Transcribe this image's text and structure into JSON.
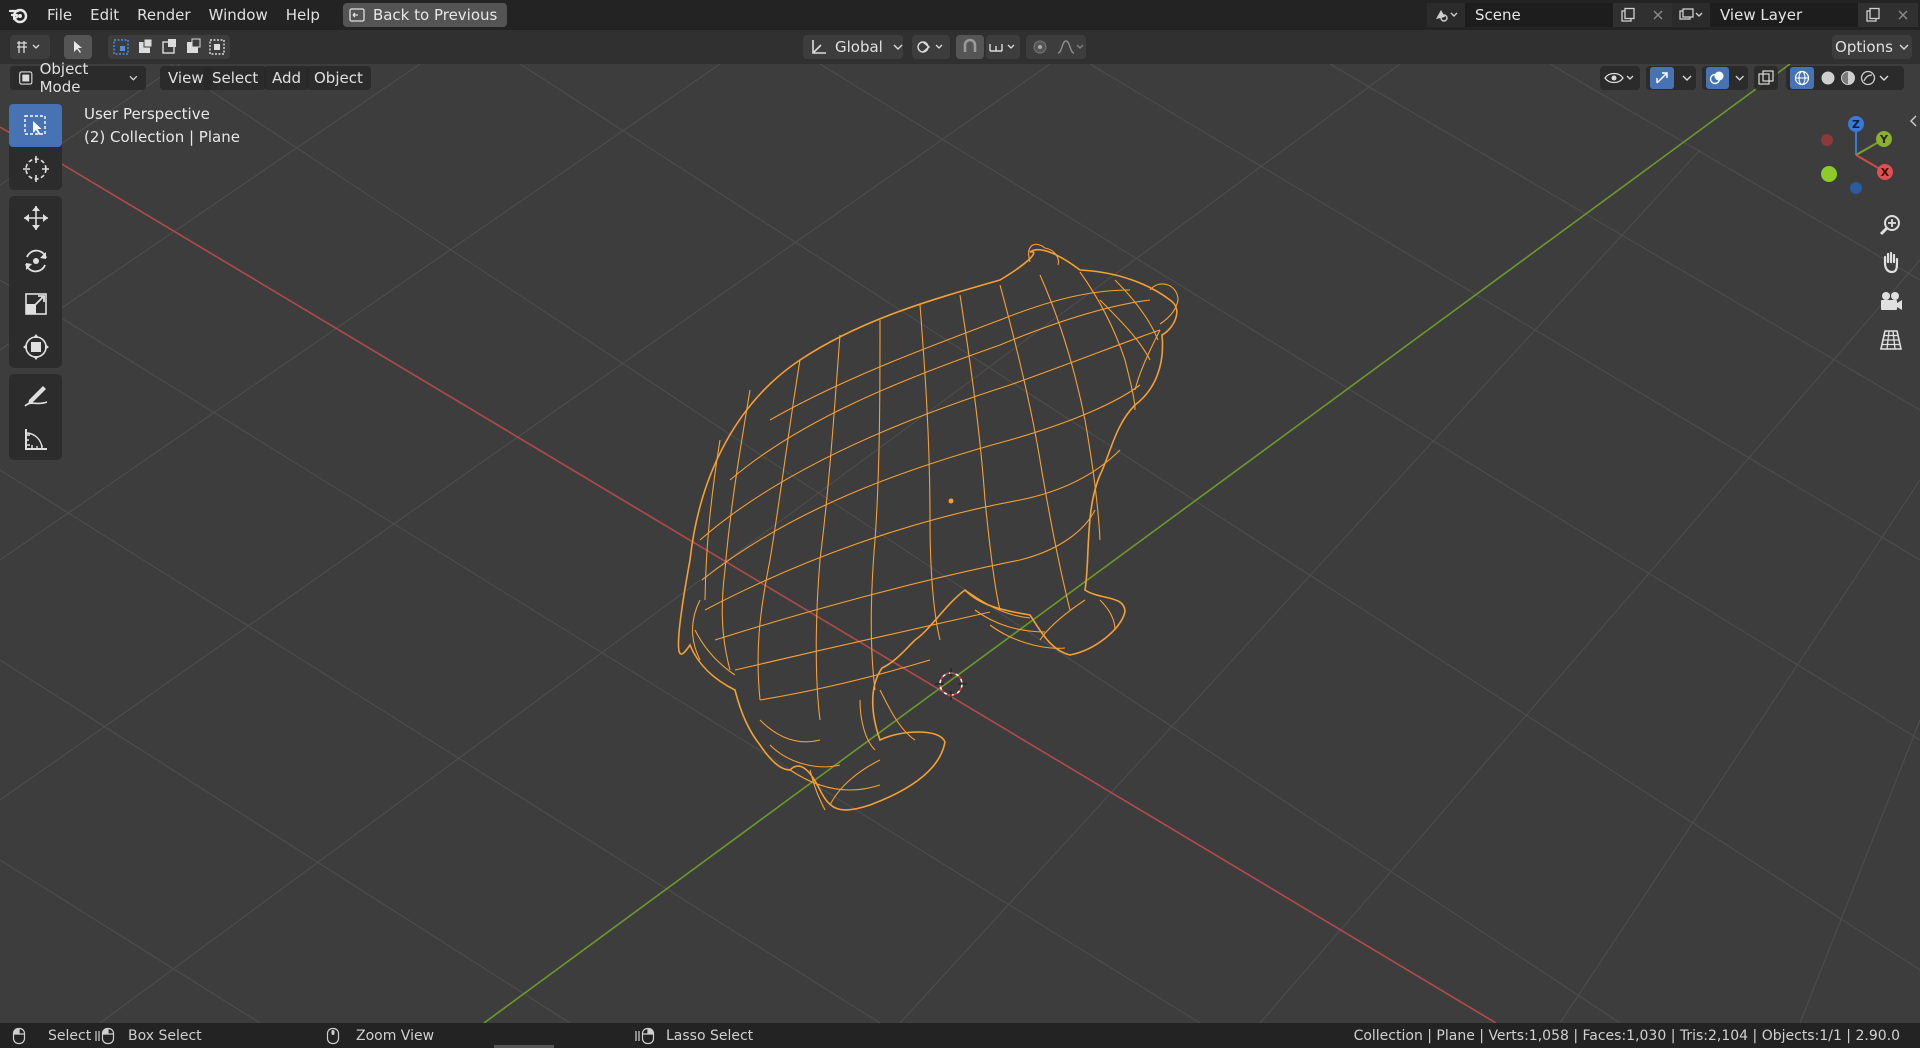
{
  "menu": {
    "items": [
      "File",
      "Edit",
      "Render",
      "Window",
      "Help"
    ],
    "back_button": "Back to Previous"
  },
  "scene": {
    "label": "Scene"
  },
  "view_layer": {
    "label": "View Layer"
  },
  "tool_settings": {
    "orientation": "Global",
    "options": "Options"
  },
  "viewport_header": {
    "mode": "Object Mode",
    "view": "View",
    "select": "Select",
    "add": "Add",
    "object": "Object"
  },
  "viewport": {
    "perspective": "User Perspective",
    "collection_info": "(2) Collection | Plane",
    "gizmo": {
      "x": "X",
      "y": "Y",
      "z": "Z"
    }
  },
  "status": {
    "select": "Select",
    "box_select": "Box Select",
    "zoom_view": "Zoom View",
    "lasso_select": "Lasso Select",
    "stats": "Collection | Plane | Verts:1,058 | Faces:1,030 | Tris:2,104 | Objects:1/1 | 2.90.0"
  },
  "colors": {
    "axis_x": "#b34a4a",
    "axis_y": "#6a9a2a",
    "selection": "#f5a033",
    "active_tool": "#4772b3"
  }
}
